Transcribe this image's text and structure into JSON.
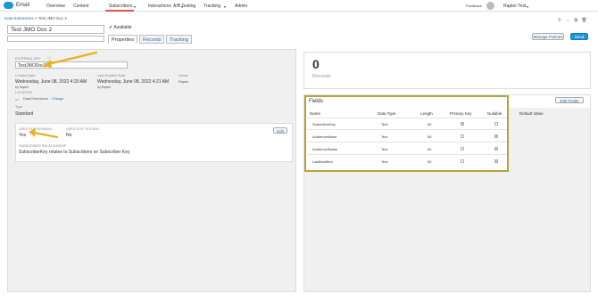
{
  "topnav": {
    "app_name": "Email",
    "items": [
      "Overview",
      "Content",
      "Subscribers",
      "Interactions",
      "A/B Testing",
      "Tracking",
      "Admin"
    ],
    "active": "Subscribers",
    "feedback": "Feedback",
    "user": "Raptor Test"
  },
  "breadcrumb": {
    "root": "Data Extensions",
    "sep": ">",
    "current": "Test JMO Doc 2"
  },
  "header": {
    "title_value": "Test JMO Doc 2",
    "available_label": "Available",
    "tabs": [
      "Properties",
      "Records",
      "Tracking"
    ],
    "manage_policies": "Manage Policies",
    "send": "Send"
  },
  "properties": {
    "external_key_label": "EXTERNAL KEY",
    "external_key_value": "TestJMODoc2",
    "created_date_label": "Created Date",
    "created_date_value": "Wednesday, June 08, 2022 4:20 AM",
    "created_by": "by Raptor",
    "modified_label": "Last Modified Date",
    "modified_value": "Wednesday, June 08, 2022 4:21 AM",
    "modified_by": "by Raptor",
    "owner_label": "Owner",
    "owner_value": "Raptor",
    "location_label": "LOCATION",
    "location_value": "Data Extensions",
    "location_change": "Change",
    "type_label": "Type",
    "type_value": "Standard",
    "sending_label": "USED FOR SENDING",
    "sending_value": "Yes",
    "testing_label": "USED FOR TESTING",
    "testing_value": "No",
    "relationship_label": "SUBSCRIBER RELATIONSHIP",
    "relationship_value": "SubscriberKey relates to Subscribers on Subscriber Key",
    "edit": "Edit"
  },
  "records": {
    "count": "0",
    "label": "Records"
  },
  "fields": {
    "title": "Fields",
    "edit": "Edit Fields",
    "columns": [
      "Name",
      "Data Type",
      "Length",
      "Primary Key",
      "Nullable",
      "Default Value"
    ],
    "rows": [
      {
        "name": "SubscriberKey",
        "type": "Text",
        "length": "50",
        "primary": true,
        "nullable": false
      },
      {
        "name": "AudienceName",
        "type": "Text",
        "length": "50",
        "primary": false,
        "nullable": true
      },
      {
        "name": "AudienceStatus",
        "type": "Text",
        "length": "50",
        "primary": false,
        "nullable": true
      },
      {
        "name": "LastModified",
        "type": "Text",
        "length": "50",
        "primary": false,
        "nullable": true
      }
    ]
  },
  "colors": {
    "accent": "#1b96d6",
    "highlight_border": "#b8a33a",
    "arrow": "#e6b422"
  }
}
